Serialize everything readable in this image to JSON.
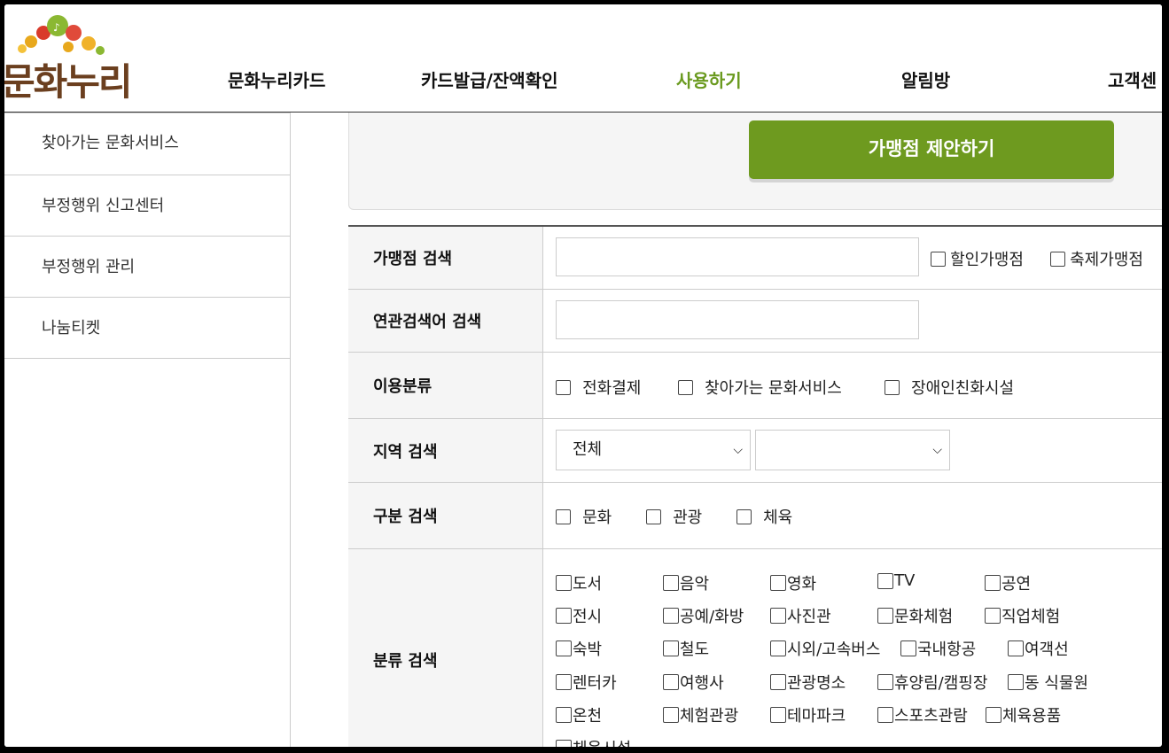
{
  "header": {
    "logo_text": "문화누리",
    "nav": [
      {
        "label": "문화누리카드"
      },
      {
        "label": "카드발급/잔액확인"
      },
      {
        "label": "사용하기",
        "active": true
      },
      {
        "label": "알림방"
      },
      {
        "label": "고객센"
      }
    ]
  },
  "sidebar": {
    "items": [
      {
        "label": "찾아가는 문화서비스"
      },
      {
        "label": "부정행위 신고센터"
      },
      {
        "label": "부정행위 관리"
      },
      {
        "label": "나눔티켓"
      }
    ]
  },
  "suggest_button": {
    "label": "가맹점 제안하기"
  },
  "search": {
    "store": {
      "label": "가맹점 검색",
      "value": "",
      "options": [
        "할인가맹점",
        "축제가맹점"
      ]
    },
    "related": {
      "label": "연관검색어 검색",
      "value": ""
    },
    "usage": {
      "label": "이용분류",
      "options": [
        "전화결제",
        "찾아가는 문화서비스",
        "장애인친화시설"
      ]
    },
    "region": {
      "label": "지역 검색",
      "select1": "전체",
      "select2": ""
    },
    "division": {
      "label": "구분 검색",
      "options": [
        "문화",
        "관광",
        "체육"
      ]
    },
    "category": {
      "label": "분류 검색",
      "rows": [
        [
          "도서",
          "음악",
          "영화",
          "TV",
          "공연"
        ],
        [
          "전시",
          "공예/화방",
          "사진관",
          "문화체험",
          "직업체험"
        ],
        [
          "숙박",
          "철도",
          "시외/고속버스",
          "국내항공",
          "여객선"
        ],
        [
          "렌터카",
          "여행사",
          "관광명소",
          "휴양림/캠핑장",
          "동 식물원"
        ],
        [
          "온천",
          "체험관광",
          "테마파크",
          "스포츠관람",
          "체육용품"
        ],
        [
          "체육시설"
        ]
      ]
    }
  },
  "colors": {
    "accent": "#6e9a1f",
    "active_nav": "#6a9a1f"
  }
}
